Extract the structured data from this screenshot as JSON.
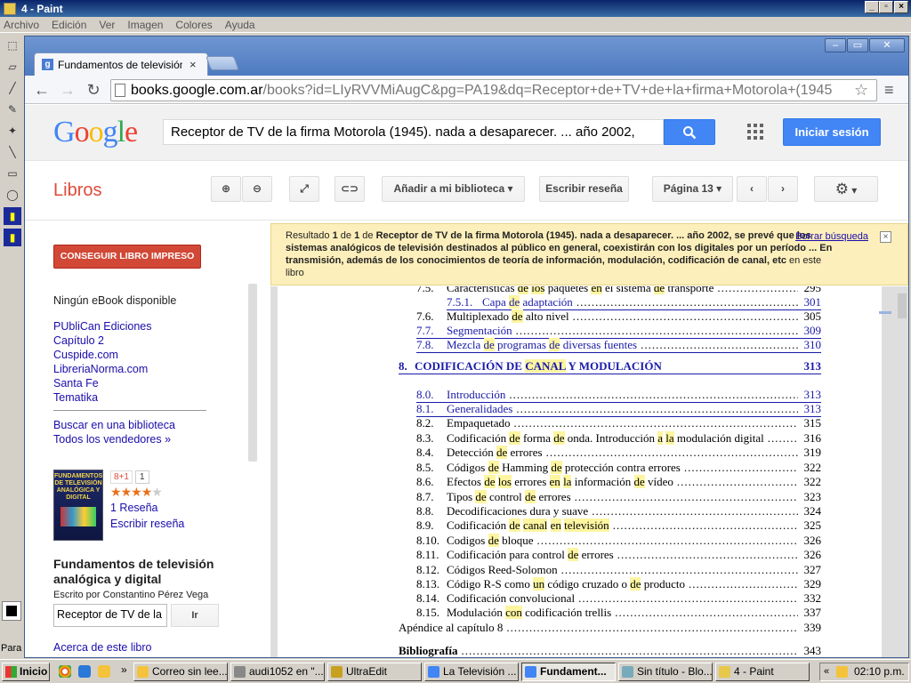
{
  "paint": {
    "title": "4 - Paint",
    "menu": [
      "Archivo",
      "Edición",
      "Ver",
      "Imagen",
      "Colores",
      "Ayuda"
    ],
    "status_left": "Para"
  },
  "browser": {
    "tab_title": "Fundamentos de televisión a",
    "url_host": "books.google.com.ar",
    "url_path": "/books?id=LIyRVVMiAugC&pg=PA19&dq=Receptor+de+TV+de+la+firma+Motorola+(1945"
  },
  "google": {
    "logo": "Google",
    "search_value": "Receptor de TV de la firma Motorola (1945). nada a desaparecer. ... año 2002,",
    "signin_label": "Iniciar sesión"
  },
  "libros": {
    "title": "Libros",
    "add_library_label": "Añadir a mi biblioteca",
    "write_review_label": "Escribir reseña",
    "page_label": "Página 13"
  },
  "sidebar": {
    "buy_label": "CONSEGUIR LIBRO IMPRESO",
    "no_ebook": "Ningún eBook disponible",
    "sellers": [
      "PUbliCan Ediciones",
      "Capítulo 2",
      "Cuspide.com",
      "LibreriaNorma.com",
      "Santa Fe",
      "Tematika"
    ],
    "library_link": "Buscar en una biblioteca",
    "all_sellers": "Todos los vendedores »",
    "gplus_label": "8+1",
    "gplus_count": "1",
    "rating": 4,
    "reviews_link": "1 Reseña",
    "write_review": "Escribir reseña",
    "book_title": "Fundamentos de televisión analógica y digital",
    "author_line": "Escrito por Constantino Pérez Vega",
    "inbook_search_value": "Receptor de TV de la",
    "go_label": "Ir",
    "about_link": "Acerca de este libro",
    "cover_text": "FUNDAMENTOS DE TELEVISIÓN ANALÓGICA Y DIGITAL"
  },
  "banner": {
    "prefix": "Resultado",
    "index": "1",
    "of": "de",
    "total": "1",
    "de2": "de",
    "query": "Receptor de TV de la firma Motorola (1945). nada a desaparecer. ... año 2002, se prevé que los sistemas analógicos de televisión destinados al público en general, coexistirán con los digitales por un período ... En transmisión, además de los conocimientos de teoría de información, modulación, codificación de canal, etc",
    "suffix": "en este libro",
    "clear_label": "Borrar búsqueda"
  },
  "toc": [
    {
      "num": "7.5.",
      "title": "Características de los paquetes en el sistema de transporte",
      "page": "295",
      "link": false,
      "cut": true
    },
    {
      "num": "7.5.1.",
      "title": "Capa de adaptación",
      "page": "301",
      "link": true,
      "sub": true
    },
    {
      "num": "7.6.",
      "title": "Multiplexado de alto nivel",
      "page": "305",
      "link": false
    },
    {
      "num": "7.7.",
      "title": "Segmentación",
      "page": "309",
      "link": true
    },
    {
      "num": "7.8.",
      "title": "Mezcla de programas de diversas fuentes",
      "page": "310",
      "link": true
    },
    {
      "num": "8.",
      "title": "CODIFICACIÓN DE CANAL Y MODULACIÓN",
      "page": "313",
      "link": true,
      "chapter": true
    },
    {
      "num": "8.0.",
      "title": "Introducción",
      "page": "313",
      "link": true
    },
    {
      "num": "8.1.",
      "title": "Generalidades",
      "page": "313",
      "link": true
    },
    {
      "num": "8.2.",
      "title": "Empaquetado",
      "page": "315",
      "link": false
    },
    {
      "num": "8.3.",
      "title": "Codificación de forma de onda. Introducción a la modulación digital",
      "page": "316",
      "link": false
    },
    {
      "num": "8.4.",
      "title": "Detección de errores",
      "page": "319",
      "link": false
    },
    {
      "num": "8.5.",
      "title": "Códigos de Hamming de protección contra errores",
      "page": "322",
      "link": false
    },
    {
      "num": "8.6.",
      "title": "Efectos de los errores en la información de vídeo",
      "page": "322",
      "link": false
    },
    {
      "num": "8.7.",
      "title": "Tipos de control de errores",
      "page": "323",
      "link": false
    },
    {
      "num": "8.8.",
      "title": "Decodificaciones dura y suave",
      "page": "324",
      "link": false
    },
    {
      "num": "8.9.",
      "title": "Codificación de canal en televisión",
      "page": "325",
      "link": false
    },
    {
      "num": "8.10.",
      "title": "Codigos de bloque",
      "page": "326",
      "link": false
    },
    {
      "num": "8.11.",
      "title": "Codificación para control de errores",
      "page": "326",
      "link": false
    },
    {
      "num": "8.12.",
      "title": "Códigos Reed-Solomon",
      "page": "327",
      "link": false
    },
    {
      "num": "8.13.",
      "title": "Código R-S como un código cruzado o de producto",
      "page": "329",
      "link": false
    },
    {
      "num": "8.14.",
      "title": "Codificación convolucional",
      "page": "332",
      "link": false
    },
    {
      "num": "8.15.",
      "title": "Modulación con codificación trellis",
      "page": "337",
      "link": false
    },
    {
      "num": "",
      "title": "Apéndice al capítulo 8",
      "page": "339",
      "link": false,
      "flush": true
    },
    {
      "num": "",
      "title": "Bibliografía",
      "page": "343",
      "link": false,
      "flush": true,
      "bold": true
    }
  ],
  "highlight_words": [
    "de",
    "a",
    "la",
    "los",
    "en",
    "con",
    "un",
    "CANAL",
    "canal",
    "televisión"
  ],
  "taskbar": {
    "start_label": "Inicio",
    "tasks": [
      "Correo sin lee...",
      "audi1052 en \"...",
      "UltraEdit",
      "La Televisión ...",
      "Fundament...",
      "Sin título - Blo...",
      "4 - Paint"
    ],
    "clock": "02:10 p.m."
  }
}
